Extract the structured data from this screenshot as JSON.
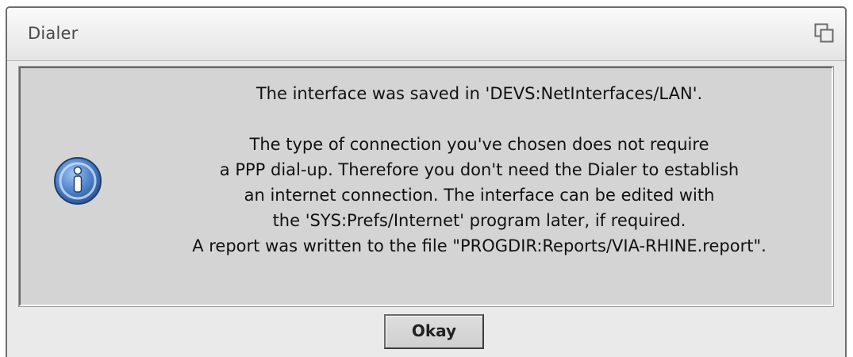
{
  "window": {
    "title": "Dialer"
  },
  "dialog": {
    "icon": "info-icon",
    "message_line_1": "The interface was saved in 'DEVS:NetInterfaces/LAN'.",
    "message_line_2": "The type of connection you've chosen does not require",
    "message_line_3": "a PPP dial-up. Therefore you don't need the Dialer to establish",
    "message_line_4": "an internet connection. The interface can be edited with",
    "message_line_5": "the 'SYS:Prefs/Internet' program later, if required.",
    "message_line_6": "A report was written to the file \"PROGDIR:Reports/VIA-RHINE.report\".",
    "okay_label": "Okay"
  },
  "colors": {
    "panel_background": "#d4d4d4",
    "window_background": "#eaeaea",
    "icon_blue": "#3f6fb4"
  }
}
